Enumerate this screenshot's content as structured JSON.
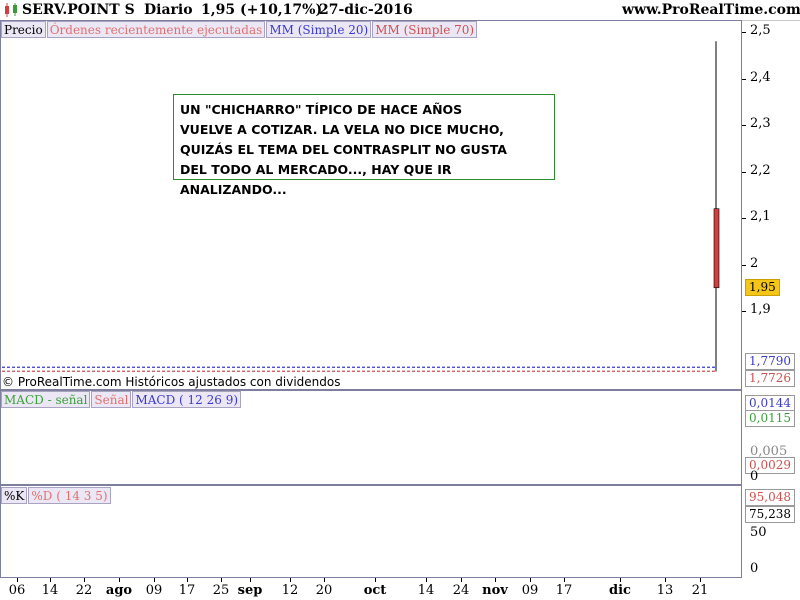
{
  "header": {
    "symbol": "SERV.POINT S",
    "period": "Diario",
    "price_change": "1,95 (+10,17%)",
    "date": "27-dic-2016",
    "site": "www.ProRealTime.com"
  },
  "price_pane": {
    "legend": [
      "Precio",
      "Órdenes recientemente ejecutadas",
      "MM (Simple 20)",
      "MM (Simple 70)"
    ],
    "legend_colors": [
      "#000000",
      "#e07070",
      "#3a3ad0",
      "#d05050"
    ],
    "y_ticks": [
      "2,5",
      "2,4",
      "2,3",
      "2,2",
      "2,1",
      "2",
      "1,9"
    ],
    "y_tick_values": [
      2.5,
      2.4,
      2.3,
      2.2,
      2.1,
      2.0,
      1.9
    ],
    "last_price": "1,95",
    "ma20_value": "1,7790",
    "ma70_value": "1,7726",
    "annotation": [
      "UN \"CHICHARRO\" TÍPICO DE HACE AÑOS",
      "VUELVE A COTIZAR. LA VELA NO DICE MUCHO,",
      "QUIZÁS EL TEMA DEL CONTRASPLIT NO GUSTA",
      "DEL TODO AL MERCADO..., HAY QUE IR ANALIZANDO..."
    ],
    "copyright": "© ProRealTime.com  Históricos ajustados con dividendos"
  },
  "macd_pane": {
    "legend": [
      "MACD - señal",
      "Señal",
      "MACD ( 12 26 9)"
    ],
    "legend_colors": [
      "#3aa03a",
      "#e07070",
      "#3a3ad0"
    ],
    "macd_value": "0,0144",
    "hist_value": "0,0115",
    "signal_value": "0,0029",
    "y_ticks": [
      "0,005",
      "0"
    ]
  },
  "stoch_pane": {
    "legend": [
      "%K",
      "%D ( 14 3 5)"
    ],
    "legend_colors": [
      "#000000",
      "#e07070"
    ],
    "d_value": "95,048",
    "k_value": "75,238",
    "y_ticks": [
      "50",
      "0"
    ]
  },
  "x_axis": [
    {
      "label": "06",
      "major": false
    },
    {
      "label": "14",
      "major": false
    },
    {
      "label": "22",
      "major": false
    },
    {
      "label": "ago",
      "major": true
    },
    {
      "label": "09",
      "major": false
    },
    {
      "label": "17",
      "major": false
    },
    {
      "label": "25",
      "major": false
    },
    {
      "label": "sep",
      "major": true
    },
    {
      "label": "12",
      "major": false
    },
    {
      "label": "20",
      "major": false
    },
    {
      "label": "oct",
      "major": true
    },
    {
      "label": "14",
      "major": false
    },
    {
      "label": "24",
      "major": false
    },
    {
      "label": "nov",
      "major": true
    },
    {
      "label": "09",
      "major": false
    },
    {
      "label": "17",
      "major": false
    },
    {
      "label": "dic",
      "major": true
    },
    {
      "label": "13",
      "major": false
    },
    {
      "label": "21",
      "major": false
    }
  ],
  "chart_data": {
    "type": "candlestick",
    "title": "SERV.POINT S  Diario",
    "ylim": [
      1.75,
      2.52
    ],
    "candle": {
      "date": "27-dic-2016",
      "open": 1.95,
      "close": 2.12,
      "high": 2.48,
      "low": 1.77,
      "color": "#d04040"
    },
    "ma20": 1.779,
    "ma70": 1.7726,
    "macd": {
      "macd": 0.0144,
      "signal": 0.0029,
      "histogram": 0.0115
    },
    "stochastic": {
      "k": 75.238,
      "d": 95.048
    }
  }
}
